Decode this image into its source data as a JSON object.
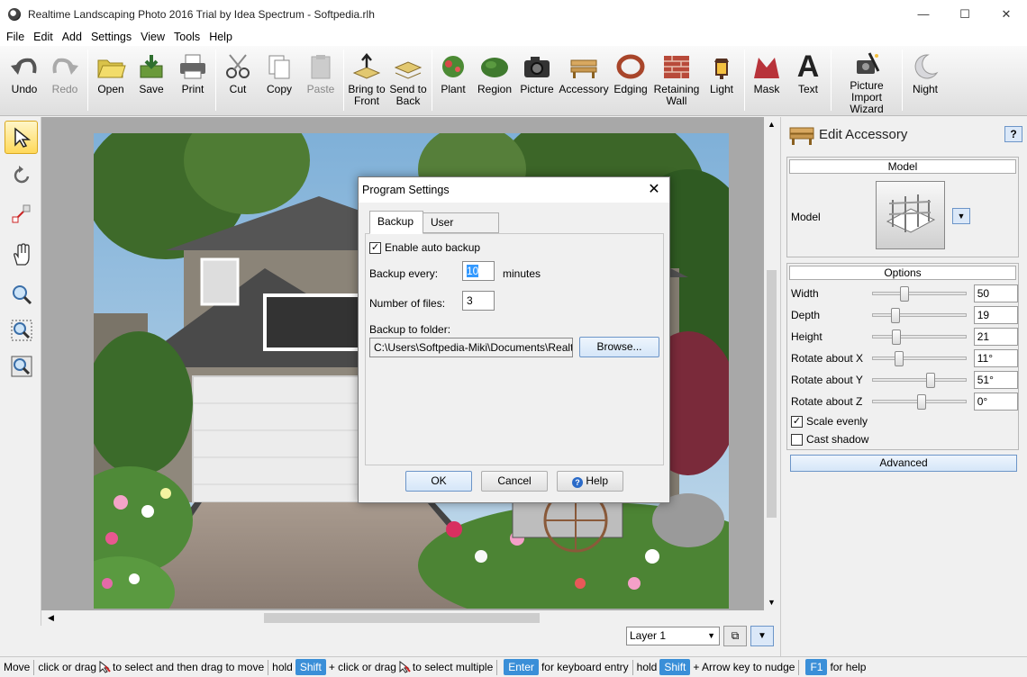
{
  "window": {
    "title": "Realtime Landscaping Photo 2016 Trial by Idea Spectrum - Softpedia.rlh",
    "minimize": "—",
    "maximize": "☐",
    "close": "✕"
  },
  "menu": [
    "File",
    "Edit",
    "Add",
    "Settings",
    "View",
    "Tools",
    "Help"
  ],
  "toolbar": [
    {
      "label": "Undo",
      "icon": "undo-icon"
    },
    {
      "label": "Redo",
      "icon": "redo-icon",
      "disabled": true
    },
    {
      "label": "Open",
      "icon": "folder-icon"
    },
    {
      "label": "Save",
      "icon": "save-icon"
    },
    {
      "label": "Print",
      "icon": "printer-icon"
    },
    {
      "label": "Cut",
      "icon": "scissors-icon"
    },
    {
      "label": "Copy",
      "icon": "copy-icon"
    },
    {
      "label": "Paste",
      "icon": "paste-icon",
      "disabled": true
    },
    {
      "label": "Bring to Front",
      "icon": "bring-front-icon"
    },
    {
      "label": "Send to Back",
      "icon": "send-back-icon"
    },
    {
      "label": "Plant",
      "icon": "plant-icon"
    },
    {
      "label": "Region",
      "icon": "region-icon"
    },
    {
      "label": "Picture",
      "icon": "camera-icon"
    },
    {
      "label": "Accessory",
      "icon": "bench-icon"
    },
    {
      "label": "Edging",
      "icon": "edging-icon"
    },
    {
      "label": "Retaining Wall",
      "icon": "brick-wall-icon"
    },
    {
      "label": "Light",
      "icon": "lantern-icon"
    },
    {
      "label": "Mask",
      "icon": "mask-icon"
    },
    {
      "label": "Text",
      "icon": "text-icon"
    },
    {
      "label": "Picture Import Wizard",
      "icon": "wizard-icon"
    },
    {
      "label": "Night",
      "icon": "moon-icon"
    }
  ],
  "colors": {
    "accent": "#3a8fd8",
    "dialog_border": "#7a7a7a"
  },
  "bottombar": {
    "layer": "Layer 1"
  },
  "status": {
    "move": "Move",
    "p1": "click or drag",
    "p2": "to select and then drag to move",
    "p3": "hold",
    "shift": "Shift",
    "p4": "+ click or drag",
    "p5": "to select multiple",
    "enter": "Enter",
    "p6": "for keyboard entry",
    "p7": "hold",
    "shift2": "Shift",
    "p8": "+ Arrow key to nudge",
    "f1": "F1",
    "p9": "for help"
  },
  "panel": {
    "title": "Edit Accessory",
    "help": "?",
    "model_header": "Model",
    "model_label": "Model",
    "options_header": "Options",
    "sliders": [
      {
        "label": "Width",
        "value": "50",
        "pos": 0.31
      },
      {
        "label": "Depth",
        "value": "19",
        "pos": 0.2
      },
      {
        "label": "Height",
        "value": "21",
        "pos": 0.21
      },
      {
        "label": "Rotate about X",
        "value": "11°",
        "pos": 0.25
      },
      {
        "label": "Rotate about Y",
        "value": "51°",
        "pos": 0.61
      },
      {
        "label": "Rotate about Z",
        "value": "0°",
        "pos": 0.51
      }
    ],
    "scale_evenly": "Scale evenly",
    "cast_shadow": "Cast shadow",
    "advanced": "Advanced"
  },
  "dialog": {
    "title": "Program Settings",
    "tab_backup": "Backup",
    "tab_ui": "User Interface",
    "enable_backup": "Enable auto backup",
    "backup_every": "Backup every:",
    "backup_value": "10",
    "minutes": "minutes",
    "num_files": "Number of files:",
    "num_value": "3",
    "folder_label": "Backup to folder:",
    "folder_path": "C:\\Users\\Softpedia-Miki\\Documents\\Realtime",
    "browse": "Browse...",
    "ok": "OK",
    "cancel": "Cancel",
    "help": "Help"
  }
}
